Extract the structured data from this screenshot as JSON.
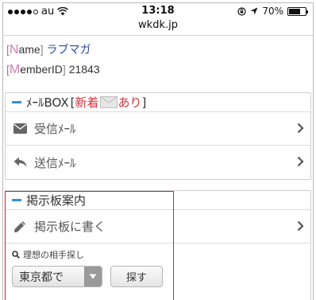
{
  "status_bar": {
    "carrier": "au",
    "time": "13:18",
    "battery": "70%",
    "battery_level": 0.7
  },
  "url_bar": {
    "url": "wkdk.jp"
  },
  "profile": {
    "name_label_first": "N",
    "name_label_rest": "ame",
    "name_value": "ラブマガ",
    "member_label_first": "M",
    "member_label_rest": "emberID",
    "member_value": "21843"
  },
  "mail_box": {
    "title": "ﾒｰﾙBOX",
    "badge_text": "新着",
    "badge_suffix": "あり",
    "items": [
      {
        "label": "受信ﾒｰﾙ",
        "icon": "envelope-icon"
      },
      {
        "label": "送信ﾒｰﾙ",
        "icon": "reply-icon"
      }
    ]
  },
  "bulletin": {
    "title": "掲示板案内",
    "write_label": "掲示板に書く",
    "search_label": "理想の相手探し",
    "select_value": "東京都で",
    "search_button": "探す"
  },
  "colors": {
    "accent_blue": "#3a8fd8",
    "badge_red": "#d3353a",
    "highlight_red": "#c9262c",
    "label_pink": "#d07fb1",
    "name_blue": "#2a4ba0"
  }
}
